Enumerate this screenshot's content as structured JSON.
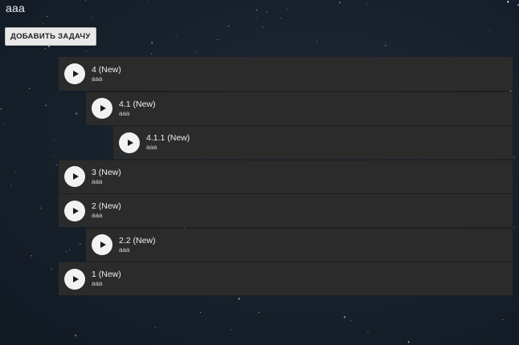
{
  "page": {
    "title": "aaa",
    "add_task_label": "ДОБАВИТЬ ЗАДАЧУ"
  },
  "tasks": [
    {
      "title": "4 (New)",
      "description": "aaa",
      "level": 0
    },
    {
      "title": "4.1 (New)",
      "description": "aaa",
      "level": 1
    },
    {
      "title": "4.1.1 (New)",
      "description": "aaa",
      "level": 2
    },
    {
      "title": "3 (New)",
      "description": "aaa",
      "level": 0
    },
    {
      "title": "2 (New)",
      "description": "aaa",
      "level": 0
    },
    {
      "title": "2.2 (New)",
      "description": "aaa",
      "level": 1
    },
    {
      "title": "1 (New)",
      "description": "aaa",
      "level": 0
    }
  ],
  "colors": {
    "background": "#16202b",
    "row": "#2b2b2b",
    "play_button": "#f2f2f2",
    "button": "#e9e9e9"
  },
  "icons": {
    "play": "play-icon"
  }
}
